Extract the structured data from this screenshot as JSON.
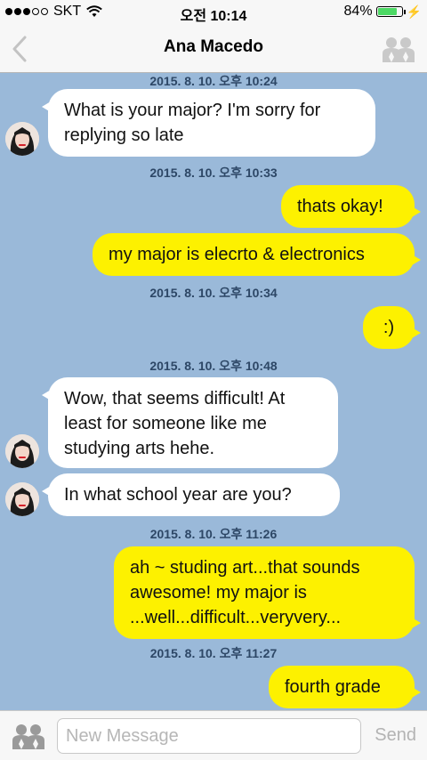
{
  "status_bar": {
    "carrier": "SKT",
    "time": "오전 10:14",
    "battery": "84%",
    "battery_level": 0.84
  },
  "nav": {
    "title": "Ana Macedo",
    "back_icon": "chevron-left-icon",
    "people_icon": "people-icon"
  },
  "messages": [
    {
      "type": "timestamp",
      "text": "2015. 8. 10. 오후 10:24"
    },
    {
      "type": "in",
      "text": "What is your major? I'm sorry for replying so late"
    },
    {
      "type": "timestamp",
      "text": "2015. 8. 10. 오후 10:33"
    },
    {
      "type": "out",
      "text": "thats okay!"
    },
    {
      "type": "out",
      "text": "my major is elecrto & electronics"
    },
    {
      "type": "timestamp",
      "text": "2015. 8. 10. 오후 10:34"
    },
    {
      "type": "out",
      "text": ":)"
    },
    {
      "type": "timestamp",
      "text": "2015. 8. 10. 오후 10:48"
    },
    {
      "type": "in",
      "text": "Wow, that seems difficult! At least for someone like me studying arts hehe."
    },
    {
      "type": "in",
      "text": "In what school year are you?"
    },
    {
      "type": "timestamp",
      "text": "2015. 8. 10. 오후 11:26"
    },
    {
      "type": "out",
      "text": "ah ~ studing art...that sounds awesome! my major is ...well...difficult...veryvery..."
    },
    {
      "type": "timestamp",
      "text": "2015. 8. 10. 오후 11:27"
    },
    {
      "type": "out",
      "text": "fourth grade"
    }
  ],
  "composer": {
    "placeholder": "New Message",
    "value": "",
    "send_label": "Send",
    "people_icon": "people-icon"
  },
  "colors": {
    "chat_background": "#9ab9d9",
    "outgoing_bubble": "#fdf100",
    "incoming_bubble": "#ffffff",
    "timestamp_text": "#2d4766",
    "battery_fill": "#4cd964"
  }
}
